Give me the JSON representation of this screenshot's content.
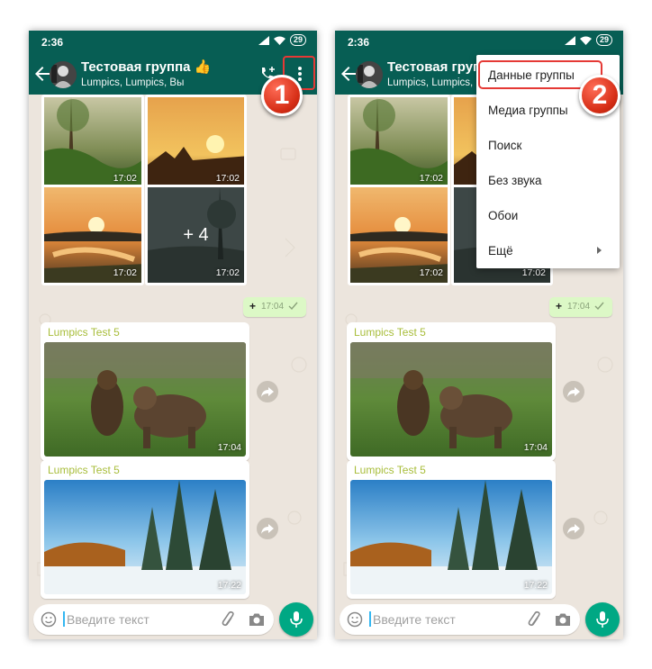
{
  "status_bar": {
    "time": "2:36",
    "battery": "29"
  },
  "chat": {
    "title": "Тестовая группа",
    "title_emoji": "👍",
    "subtitle": "Lumpics, Lumpics, Вы"
  },
  "photo_grid": {
    "times": [
      "17:02",
      "17:02",
      "17:02",
      "17:02"
    ],
    "more_label": "+ 4"
  },
  "sent_message": {
    "text": "+",
    "time": "17:04"
  },
  "messages": [
    {
      "sender": "Lumpics Test 5",
      "time": "17:04",
      "image": "bears-photo"
    },
    {
      "sender": "Lumpics Test 5",
      "time": "17:22",
      "image": "winter-forest-photo"
    }
  ],
  "composer": {
    "placeholder": "Введите текст"
  },
  "overflow_menu": {
    "items": [
      "Данные группы",
      "Медиа группы",
      "Поиск",
      "Без звука",
      "Обои",
      "Ещё"
    ]
  },
  "step_badges": [
    "1",
    "2"
  ],
  "colors": {
    "header": "#075e54",
    "accent": "#00a884",
    "chat_background": "#ece5dd",
    "outgoing_bubble": "#dcf8c6",
    "sender_name": "#a8bd3a",
    "highlight": "#e53935"
  },
  "icons": [
    "back-arrow-icon",
    "add-call-icon",
    "more-vert-icon",
    "emoji-icon",
    "attach-icon",
    "camera-icon",
    "mic-icon",
    "share-icon",
    "double-check-icon",
    "submenu-arrow-icon"
  ]
}
